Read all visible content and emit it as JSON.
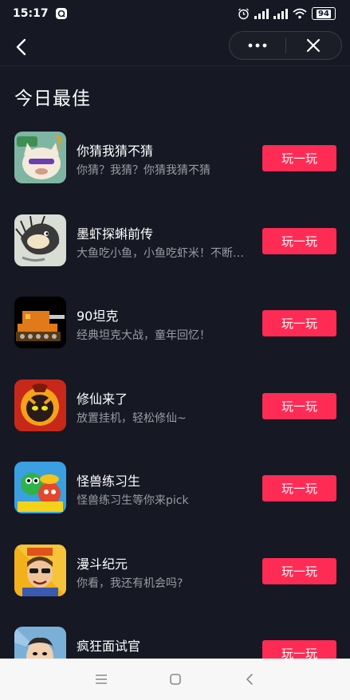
{
  "status_bar": {
    "time": "15:17",
    "battery": "94",
    "icons": [
      "message-app-icon",
      "alarm-icon",
      "signal-icon",
      "signal-icon",
      "wifi-icon",
      "battery-icon"
    ]
  },
  "nav": {
    "back_icon": "back-arrow-icon",
    "more_icon": "more-dots-icon",
    "close_icon": "close-icon"
  },
  "page": {
    "title": "今日最佳"
  },
  "colors": {
    "background": "#161823",
    "accent": "#fe2c55",
    "text_secondary": "#9a9ba3"
  },
  "games": [
    {
      "name": "你猜我猜不猜",
      "desc": "你猜？我猜？你猜我猜不猜",
      "button": "玩一玩",
      "icon": "cat-meme-icon"
    },
    {
      "name": "墨虾探蝌前传",
      "desc": "大鱼吃小鱼，小鱼吃虾米！不断成长",
      "button": "玩一玩",
      "icon": "ink-shrimp-icon"
    },
    {
      "name": "90坦克",
      "desc": "经典坦克大战，童年回忆！",
      "button": "玩一玩",
      "icon": "tank-icon"
    },
    {
      "name": "修仙来了",
      "desc": "放置挂机，轻松修仙~",
      "button": "玩一玩",
      "icon": "cultivation-icon"
    },
    {
      "name": "怪兽练习生",
      "desc": "怪兽练习生等你来pick",
      "button": "玩一玩",
      "icon": "monster-icon"
    },
    {
      "name": "漫斗纪元",
      "desc": "你看，我还有机会吗?",
      "button": "玩一玩",
      "icon": "cartoon-hero-icon"
    },
    {
      "name": "疯狂面试官",
      "desc": "",
      "button": "玩一玩",
      "icon": "interviewer-icon"
    }
  ],
  "bottom_nav": {
    "icons": [
      "menu-icon",
      "home-square-icon",
      "back-chevron-icon"
    ]
  }
}
